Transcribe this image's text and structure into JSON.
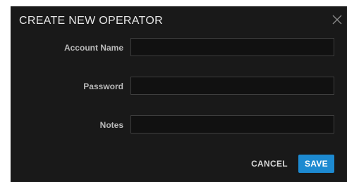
{
  "dialog": {
    "title": "CREATE NEW OPERATOR",
    "close_icon": "close-icon"
  },
  "form": {
    "fields": [
      {
        "label": "Account Name",
        "value": "",
        "placeholder": ""
      },
      {
        "label": "Password",
        "value": "",
        "placeholder": ""
      },
      {
        "label": "Notes",
        "value": "",
        "placeholder": ""
      }
    ]
  },
  "actions": {
    "cancel_label": "CANCEL",
    "save_label": "SAVE"
  },
  "colors": {
    "dialog_background": "#191919",
    "accent": "#1d8ad1",
    "text": "#e6e6e6"
  }
}
